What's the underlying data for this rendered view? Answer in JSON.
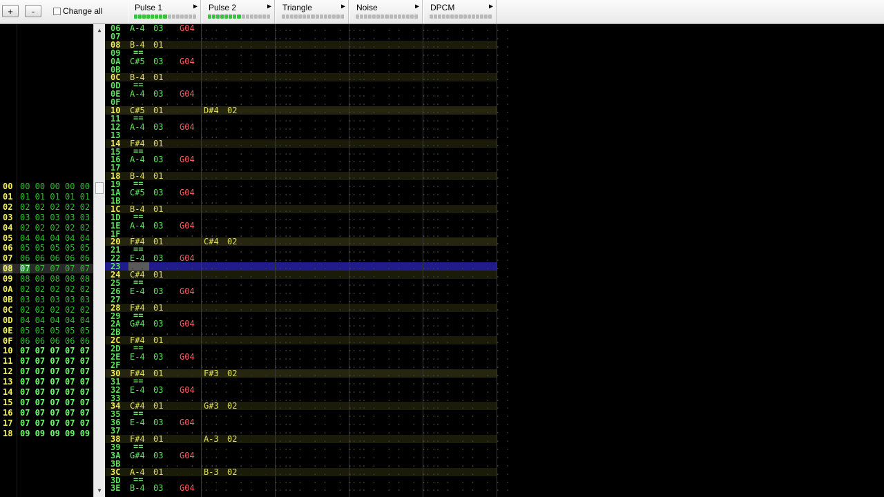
{
  "toolbar": {
    "add_frame": "+",
    "remove_frame": "-",
    "change_all_label": "Change all"
  },
  "channels": [
    {
      "name": "Pulse 1",
      "active_segments": 8
    },
    {
      "name": "Pulse 2",
      "active_segments": 8
    },
    {
      "name": "Triangle",
      "active_segments": 0
    },
    {
      "name": "Noise",
      "active_segments": 0
    },
    {
      "name": "DPCM",
      "active_segments": 0
    }
  ],
  "frames": {
    "selected": "08",
    "rows": [
      {
        "num": "00",
        "values": "00 00 00 00 00"
      },
      {
        "num": "01",
        "values": "01 01 01 01 01"
      },
      {
        "num": "02",
        "values": "02 02 02 02 02"
      },
      {
        "num": "03",
        "values": "03 03 03 03 03"
      },
      {
        "num": "04",
        "values": "02 02 02 02 02"
      },
      {
        "num": "05",
        "values": "04 04 04 04 04"
      },
      {
        "num": "06",
        "values": "05 05 05 05 05"
      },
      {
        "num": "07",
        "values": "06 06 06 06 06"
      },
      {
        "num": "08",
        "values": "07 07 07 07 07"
      },
      {
        "num": "09",
        "values": "08 08 08 08 08"
      },
      {
        "num": "0A",
        "values": "02 02 02 02 02"
      },
      {
        "num": "0B",
        "values": "03 03 03 03 03"
      },
      {
        "num": "0C",
        "values": "02 02 02 02 02"
      },
      {
        "num": "0D",
        "values": "04 04 04 04 04"
      },
      {
        "num": "0E",
        "values": "05 05 05 05 05"
      },
      {
        "num": "0F",
        "values": "06 06 06 06 06"
      },
      {
        "num": "10",
        "values": "07 07 07 07 07"
      },
      {
        "num": "11",
        "values": "07 07 07 07 07"
      },
      {
        "num": "12",
        "values": "07 07 07 07 07"
      },
      {
        "num": "13",
        "values": "07 07 07 07 07"
      },
      {
        "num": "14",
        "values": "07 07 07 07 07"
      },
      {
        "num": "15",
        "values": "07 07 07 07 07"
      },
      {
        "num": "16",
        "values": "07 07 07 07 07"
      },
      {
        "num": "17",
        "values": "07 07 07 07 07"
      },
      {
        "num": "18",
        "values": "09 09 09 09 09"
      }
    ]
  },
  "pattern": {
    "cursor_row": "23",
    "rows": [
      {
        "num": "06",
        "p1": {
          "note": "A-4",
          "inst": "03",
          "eff": "G04"
        }
      },
      {
        "num": "07"
      },
      {
        "num": "08",
        "p1": {
          "note": "B-4",
          "inst": "01"
        }
      },
      {
        "num": "09",
        "p1": {
          "release": "=="
        }
      },
      {
        "num": "0A",
        "p1": {
          "note": "C#5",
          "inst": "03",
          "eff": "G04"
        }
      },
      {
        "num": "0B"
      },
      {
        "num": "0C",
        "p1": {
          "note": "B-4",
          "inst": "01"
        }
      },
      {
        "num": "0D",
        "p1": {
          "release": "=="
        }
      },
      {
        "num": "0E",
        "p1": {
          "note": "A-4",
          "inst": "03",
          "eff": "G04"
        }
      },
      {
        "num": "0F"
      },
      {
        "num": "10",
        "p1": {
          "note": "C#5",
          "inst": "01"
        },
        "p2": {
          "note": "D#4",
          "inst": "02"
        }
      },
      {
        "num": "11",
        "p1": {
          "release": "=="
        }
      },
      {
        "num": "12",
        "p1": {
          "note": "A-4",
          "inst": "03",
          "eff": "G04"
        }
      },
      {
        "num": "13"
      },
      {
        "num": "14",
        "p1": {
          "note": "F#4",
          "inst": "01"
        }
      },
      {
        "num": "15",
        "p1": {
          "release": "=="
        }
      },
      {
        "num": "16",
        "p1": {
          "note": "A-4",
          "inst": "03",
          "eff": "G04"
        }
      },
      {
        "num": "17"
      },
      {
        "num": "18",
        "p1": {
          "note": "B-4",
          "inst": "01"
        }
      },
      {
        "num": "19",
        "p1": {
          "release": "=="
        }
      },
      {
        "num": "1A",
        "p1": {
          "note": "C#5",
          "inst": "03",
          "eff": "G04"
        }
      },
      {
        "num": "1B"
      },
      {
        "num": "1C",
        "p1": {
          "note": "B-4",
          "inst": "01"
        }
      },
      {
        "num": "1D",
        "p1": {
          "release": "=="
        }
      },
      {
        "num": "1E",
        "p1": {
          "note": "A-4",
          "inst": "03",
          "eff": "G04"
        }
      },
      {
        "num": "1F"
      },
      {
        "num": "20",
        "p1": {
          "note": "F#4",
          "inst": "01"
        },
        "p2": {
          "note": "C#4",
          "inst": "02"
        }
      },
      {
        "num": "21",
        "p1": {
          "release": "=="
        }
      },
      {
        "num": "22",
        "p1": {
          "note": "E-4",
          "inst": "03",
          "eff": "G04"
        }
      },
      {
        "num": "23"
      },
      {
        "num": "24",
        "p1": {
          "note": "C#4",
          "inst": "01"
        }
      },
      {
        "num": "25",
        "p1": {
          "release": "=="
        }
      },
      {
        "num": "26",
        "p1": {
          "note": "E-4",
          "inst": "03",
          "eff": "G04"
        }
      },
      {
        "num": "27"
      },
      {
        "num": "28",
        "p1": {
          "note": "F#4",
          "inst": "01"
        }
      },
      {
        "num": "29",
        "p1": {
          "release": "=="
        }
      },
      {
        "num": "2A",
        "p1": {
          "note": "G#4",
          "inst": "03",
          "eff": "G04"
        }
      },
      {
        "num": "2B"
      },
      {
        "num": "2C",
        "p1": {
          "note": "F#4",
          "inst": "01"
        }
      },
      {
        "num": "2D",
        "p1": {
          "release": "=="
        }
      },
      {
        "num": "2E",
        "p1": {
          "note": "E-4",
          "inst": "03",
          "eff": "G04"
        }
      },
      {
        "num": "2F"
      },
      {
        "num": "30",
        "p1": {
          "note": "F#4",
          "inst": "01"
        },
        "p2": {
          "note": "F#3",
          "inst": "02"
        }
      },
      {
        "num": "31",
        "p1": {
          "release": "=="
        }
      },
      {
        "num": "32",
        "p1": {
          "note": "E-4",
          "inst": "03",
          "eff": "G04"
        }
      },
      {
        "num": "33"
      },
      {
        "num": "34",
        "p1": {
          "note": "C#4",
          "inst": "01"
        },
        "p2": {
          "note": "G#3",
          "inst": "02"
        }
      },
      {
        "num": "35",
        "p1": {
          "release": "=="
        }
      },
      {
        "num": "36",
        "p1": {
          "note": "E-4",
          "inst": "03",
          "eff": "G04"
        }
      },
      {
        "num": "37"
      },
      {
        "num": "38",
        "p1": {
          "note": "F#4",
          "inst": "01"
        },
        "p2": {
          "note": "A-3",
          "inst": "02"
        }
      },
      {
        "num": "39",
        "p1": {
          "release": "=="
        }
      },
      {
        "num": "3A",
        "p1": {
          "note": "G#4",
          "inst": "03",
          "eff": "G04"
        }
      },
      {
        "num": "3B"
      },
      {
        "num": "3C",
        "p1": {
          "note": "A-4",
          "inst": "01"
        },
        "p2": {
          "note": "B-3",
          "inst": "02"
        }
      },
      {
        "num": "3D",
        "p1": {
          "release": "=="
        }
      },
      {
        "num": "3E",
        "p1": {
          "note": "B-4",
          "inst": "03",
          "eff": "G04"
        }
      }
    ]
  },
  "colors": {
    "note_green": "#5ee35e",
    "note_yellow": "#e0e055",
    "effect_red": "#ff5a5a",
    "cursor_row": "#201c8c",
    "meter_on": "#36c23a"
  },
  "icons": {
    "channel_expand": "triangle-right-icon",
    "scroll_up": "arrow-up-icon",
    "scroll_down": "arrow-down-icon"
  }
}
